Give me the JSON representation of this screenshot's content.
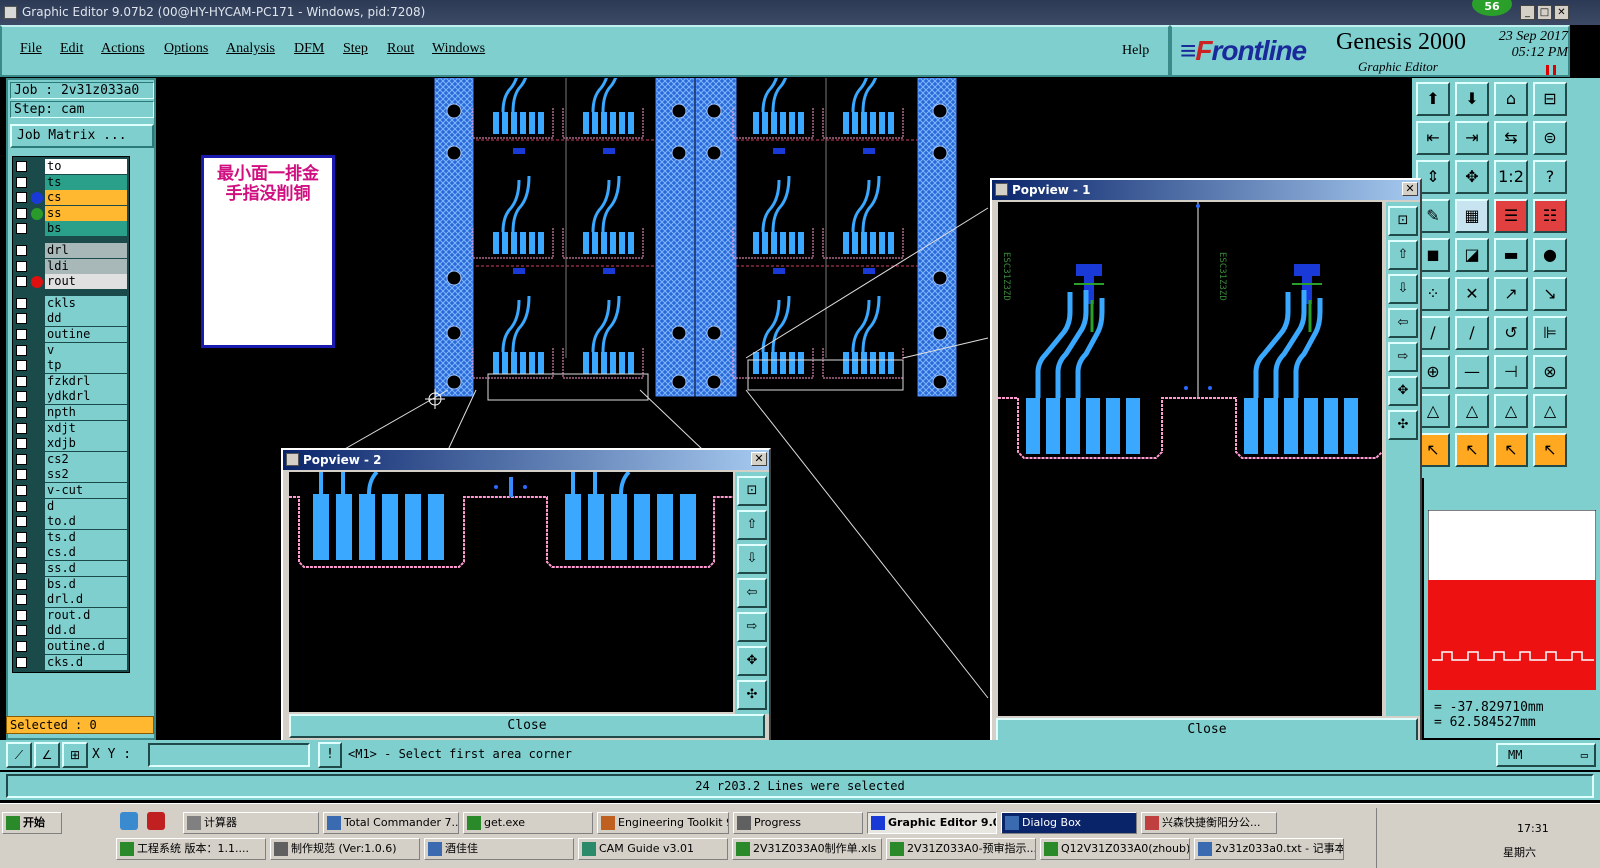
{
  "window": {
    "title": "Graphic Editor 9.07b2 (00@HY-HYCAM-PC171 - Windows, pid:7208)",
    "badge": "56"
  },
  "menu": {
    "items": [
      "File",
      "Edit",
      "Actions",
      "Options",
      "Analysis",
      "DFM",
      "Step",
      "Rout",
      "Windows"
    ],
    "help": "Help"
  },
  "brand": {
    "frontline_pre": "F",
    "frontline_post": "rontline",
    "product": "Genesis 2000",
    "subtitle": "Graphic Editor",
    "date_line1": "23 Sep 2017",
    "date_line2": "05:12 PM"
  },
  "job": {
    "job_label": "Job : 2v31z033a0",
    "step_label": "Step: cam",
    "matrix_button": "Job Matrix ...",
    "selected": "Selected : 0"
  },
  "layers": [
    {
      "name": "to",
      "bg": "#ffffff",
      "dot": ""
    },
    {
      "name": "ts",
      "bg": "#2aa08a",
      "dot": ""
    },
    {
      "name": "cs",
      "bg": "#ffb830",
      "dot": "#1a3ad8"
    },
    {
      "name": "ss",
      "bg": "#ffb830",
      "dot": "#2a9a2a"
    },
    {
      "name": "bs",
      "bg": "#2aa08a",
      "dot": ""
    },
    {
      "name": "drl",
      "bg": "#a8b8b8",
      "dot": ""
    },
    {
      "name": "ldi",
      "bg": "#a8b8b8",
      "dot": ""
    },
    {
      "name": "rout",
      "bg": "#e0e0e0",
      "dot": "#e01010"
    },
    {
      "name": "ckls",
      "bg": "#7fcfcf",
      "dot": ""
    },
    {
      "name": "dd",
      "bg": "#7fcfcf",
      "dot": ""
    },
    {
      "name": "outine",
      "bg": "#7fcfcf",
      "dot": ""
    },
    {
      "name": "v",
      "bg": "#7fcfcf",
      "dot": ""
    },
    {
      "name": "tp",
      "bg": "#7fcfcf",
      "dot": ""
    },
    {
      "name": "fzkdrl",
      "bg": "#7fcfcf",
      "dot": ""
    },
    {
      "name": "ydkdrl",
      "bg": "#7fcfcf",
      "dot": ""
    },
    {
      "name": "npth",
      "bg": "#7fcfcf",
      "dot": ""
    },
    {
      "name": "xdjt",
      "bg": "#7fcfcf",
      "dot": ""
    },
    {
      "name": "xdjb",
      "bg": "#7fcfcf",
      "dot": ""
    },
    {
      "name": "cs2",
      "bg": "#7fcfcf",
      "dot": ""
    },
    {
      "name": "ss2",
      "bg": "#7fcfcf",
      "dot": ""
    },
    {
      "name": "v-cut",
      "bg": "#7fcfcf",
      "dot": ""
    },
    {
      "name": "d",
      "bg": "#7fcfcf",
      "dot": ""
    },
    {
      "name": "to.d",
      "bg": "#7fcfcf",
      "dot": ""
    },
    {
      "name": "ts.d",
      "bg": "#7fcfcf",
      "dot": ""
    },
    {
      "name": "cs.d",
      "bg": "#7fcfcf",
      "dot": ""
    },
    {
      "name": "ss.d",
      "bg": "#7fcfcf",
      "dot": ""
    },
    {
      "name": "bs.d",
      "bg": "#7fcfcf",
      "dot": ""
    },
    {
      "name": "drl.d",
      "bg": "#7fcfcf",
      "dot": ""
    },
    {
      "name": "rout.d",
      "bg": "#7fcfcf",
      "dot": ""
    },
    {
      "name": "dd.d",
      "bg": "#7fcfcf",
      "dot": ""
    },
    {
      "name": "outine.d",
      "bg": "#7fcfcf",
      "dot": ""
    },
    {
      "name": "cks.d",
      "bg": "#7fcfcf",
      "dot": ""
    }
  ],
  "note": {
    "line1": "最小面一排金",
    "line2": "手指没削铜"
  },
  "popview1": {
    "title": "Popview - 1",
    "close": "Close",
    "label_left": "ESC31Z3ZD",
    "label_right": "ESC31Z3ZD"
  },
  "popview2": {
    "title": "Popview - 2",
    "close": "Close"
  },
  "coords": {
    "x": "= -37.829710mm",
    "y": "= 62.584527mm",
    "units": "MM"
  },
  "status": {
    "xy_label": "X Y :",
    "xy_value": "",
    "prompt": "<M1> - Select first area corner",
    "message": "24 r203.2 Lines were selected"
  },
  "taskbar": {
    "start": "开始",
    "row1": [
      "计算器",
      "Total Commander 7....",
      "get.exe",
      "Engineering Toolkit 9...",
      "Progress",
      "Graphic Editor 9.0...",
      "Dialog Box",
      "兴森快捷衡阳分公..."
    ],
    "row2": [
      "工程系统 版本：1.1....",
      "制作规范 (Ver:1.0.6)",
      "酒佳佳",
      "CAM Guide v3.01",
      "2V31Z033A0制作单.xls ...",
      "2V31Z033A0-预审指示....",
      "Q12V31Z033A0(zhoub)...",
      "2v31z033a0.txt - 记事本"
    ],
    "time": "17:31",
    "weekday": "星期六"
  }
}
